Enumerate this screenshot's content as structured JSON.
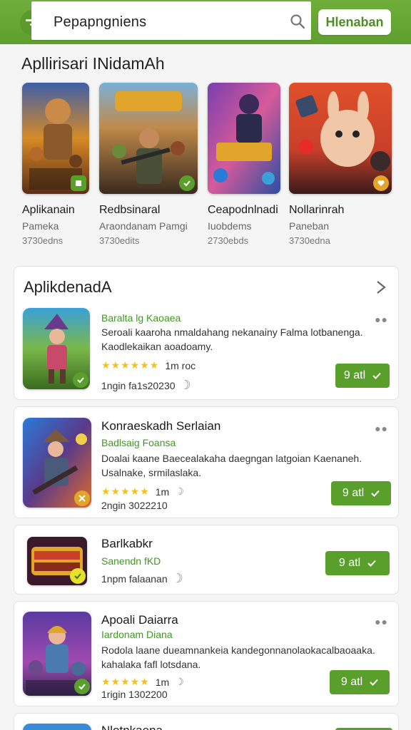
{
  "header": {
    "search_value": "Pepapngniens",
    "action_label": "Hlenaban"
  },
  "featured": {
    "title": "Apllirisari INidamAh",
    "items": [
      {
        "name": "Aplikanain",
        "subtitle": "Pameka",
        "count": "3730edns"
      },
      {
        "name": "Redbsinaral",
        "subtitle": "Araondanam Pamgi",
        "count": "3730edits"
      },
      {
        "name": "Ceapodnlnadi",
        "subtitle": "Iuobdems",
        "count": "2730ebds"
      },
      {
        "name": "Nollarinrah",
        "subtitle": "Paneban",
        "count": "3730edna"
      }
    ]
  },
  "list_section": {
    "title": "AplikdenadA",
    "apps": [
      {
        "title": "",
        "developer": "Baralta lg Kaoaea",
        "desc1": "Seroali kaaroha nmaldahang nekanainy Falma lotbanenga.",
        "desc2": "Kaodlekaikan aoadoamy.",
        "rating": "1m roc",
        "meta": "1ngin fa1s20230",
        "install": "9 atl"
      },
      {
        "title": "Konraeskadh Serlaian",
        "developer": "Badlsaig Foansa",
        "desc1": "Doalai kaane Baecealakaha daegngan latgoian Kaenaneh.",
        "desc2": "Usalnake, srmilaslaka.",
        "rating": "1m",
        "meta": "2ngin 3022210",
        "install": "9 atl"
      },
      {
        "title": "Barlkabkr",
        "developer": "Sanendn fKD",
        "desc1": "",
        "desc2": "",
        "rating": "",
        "meta": "1npm falaanan",
        "install": "9 atl"
      },
      {
        "title": "Apoali Daiarra",
        "developer": "Iardonam Diana",
        "desc1": "Rodola laane dueamnankeia kandegonnanolaokacalbaoaaka.",
        "desc2": "kahalaka fafl lotsdana.",
        "rating": "1m",
        "meta": "1rigin 1302200",
        "install": "9 atl"
      },
      {
        "title": "Nlotnkaena",
        "developer": "",
        "desc1": "",
        "desc2": "",
        "rating": "",
        "meta": "",
        "install": ""
      }
    ]
  },
  "colors": {
    "brand_green": "#5e9f2e",
    "developer_green": "#3d9a1d",
    "star_yellow": "#f2c21b"
  },
  "icons": [
    "menu-icon",
    "search-icon",
    "chevron-right-icon",
    "check-icon",
    "more-icon",
    "moon-icon",
    "star-icon"
  ]
}
